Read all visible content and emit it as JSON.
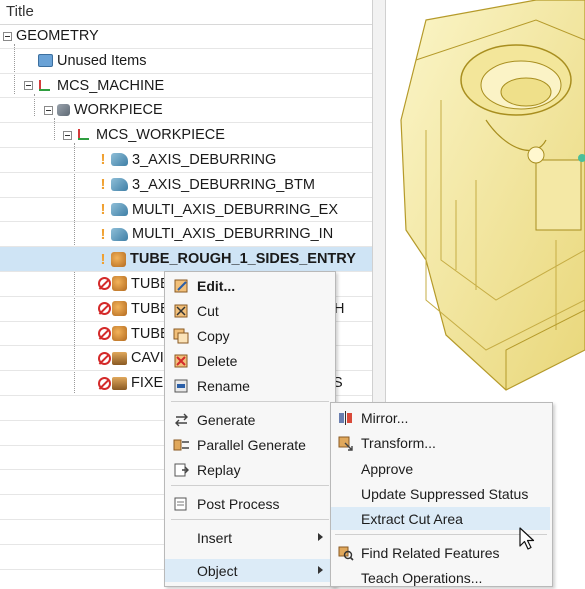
{
  "tree": {
    "header": "Title",
    "rows": [
      {
        "label": "GEOMETRY"
      },
      {
        "label": "Unused Items"
      },
      {
        "label": "MCS_MACHINE"
      },
      {
        "label": "WORKPIECE"
      },
      {
        "label": "MCS_WORKPIECE"
      },
      {
        "label": "3_AXIS_DEBURRING"
      },
      {
        "label": "3_AXIS_DEBURRING_BTM"
      },
      {
        "label": "MULTI_AXIS_DEBURRING_EX"
      },
      {
        "label": "MULTI_AXIS_DEBURRING_IN"
      },
      {
        "label": "TUBE_ROUGH_1_SIDES_ENTRY"
      },
      {
        "label": "TUBE"
      },
      {
        "label": "TUBE",
        "tail": "H"
      },
      {
        "label": "TUBE"
      },
      {
        "label": "CAVI"
      },
      {
        "label": "FIXE",
        "tail": "S"
      }
    ]
  },
  "context_menu": {
    "items": [
      {
        "label": "Edit...",
        "icon": "edit-icon"
      },
      {
        "label": "Cut",
        "icon": "cut-icon"
      },
      {
        "label": "Copy",
        "icon": "copy-icon"
      },
      {
        "label": "Delete",
        "icon": "delete-icon"
      },
      {
        "label": "Rename",
        "icon": "rename-icon"
      },
      {
        "label": "Generate",
        "icon": "generate-icon"
      },
      {
        "label": "Parallel Generate",
        "icon": "parallel-generate-icon"
      },
      {
        "label": "Replay",
        "icon": "replay-icon"
      },
      {
        "label": "Post Process",
        "icon": "post-process-icon"
      },
      {
        "label": "Insert",
        "icon": ""
      },
      {
        "label": "Object",
        "icon": ""
      }
    ]
  },
  "submenu": {
    "items": [
      {
        "label": "Mirror...",
        "icon": "mirror-icon"
      },
      {
        "label": "Transform...",
        "icon": "transform-icon"
      },
      {
        "label": "Approve",
        "icon": ""
      },
      {
        "label": "Update Suppressed Status",
        "icon": ""
      },
      {
        "label": "Extract Cut Area",
        "icon": ""
      },
      {
        "label": "Find Related Features",
        "icon": "find-related-features-icon"
      },
      {
        "label": "Teach Operations...",
        "icon": ""
      }
    ]
  },
  "colors": {
    "selection": "#cfe4f5",
    "menu_highlight": "#dcebf7",
    "warning": "#f0a030",
    "suppressed": "#d42a2a",
    "model_yellow": "#f6eba0"
  }
}
